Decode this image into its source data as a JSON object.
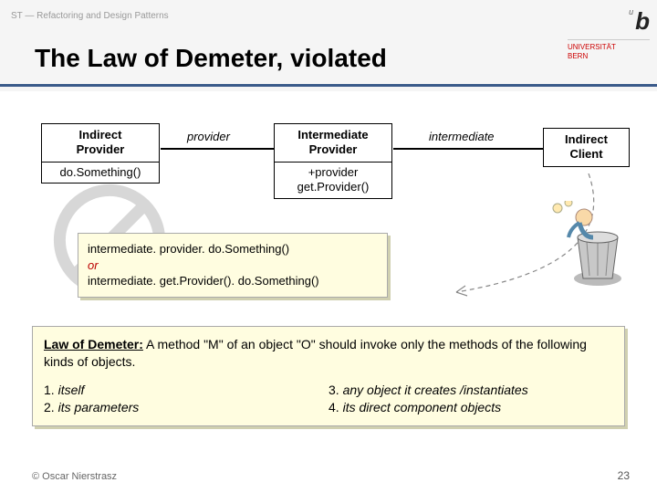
{
  "header": {
    "topic": "ST — Refactoring and Design Patterns",
    "title": "The Law of Demeter, violated"
  },
  "logo": {
    "sup": "u",
    "letter": "b",
    "uni1": "UNIVERSITÄT",
    "uni2": "BERN"
  },
  "diagram": {
    "box1": {
      "name": "Indirect\nProvider",
      "method": "do.Something()"
    },
    "box2": {
      "name": "Intermediate\nProvider",
      "attr": "+provider",
      "method": "get.Provider()"
    },
    "box3": {
      "name": "Indirect\nClient"
    },
    "label1": "provider",
    "label2": "intermediate"
  },
  "code": {
    "line1": "intermediate. provider. do.Something()",
    "or": "or",
    "line2": "intermediate. get.Provider(). do.Something()"
  },
  "law": {
    "title": "Law of Demeter:",
    "desc": " A method \"M\" of an object \"O\" should invoke only the methods of the following kinds of objects.",
    "items": {
      "n1": "1. ",
      "t1": "itself",
      "n2": "2. ",
      "t2": "its parameters",
      "n3": "3. ",
      "t3": "any object it creates /instantiates",
      "n4": "4. ",
      "t4": "its direct component objects"
    }
  },
  "footer": {
    "copyright": "© Oscar Nierstrasz",
    "page": "23"
  }
}
